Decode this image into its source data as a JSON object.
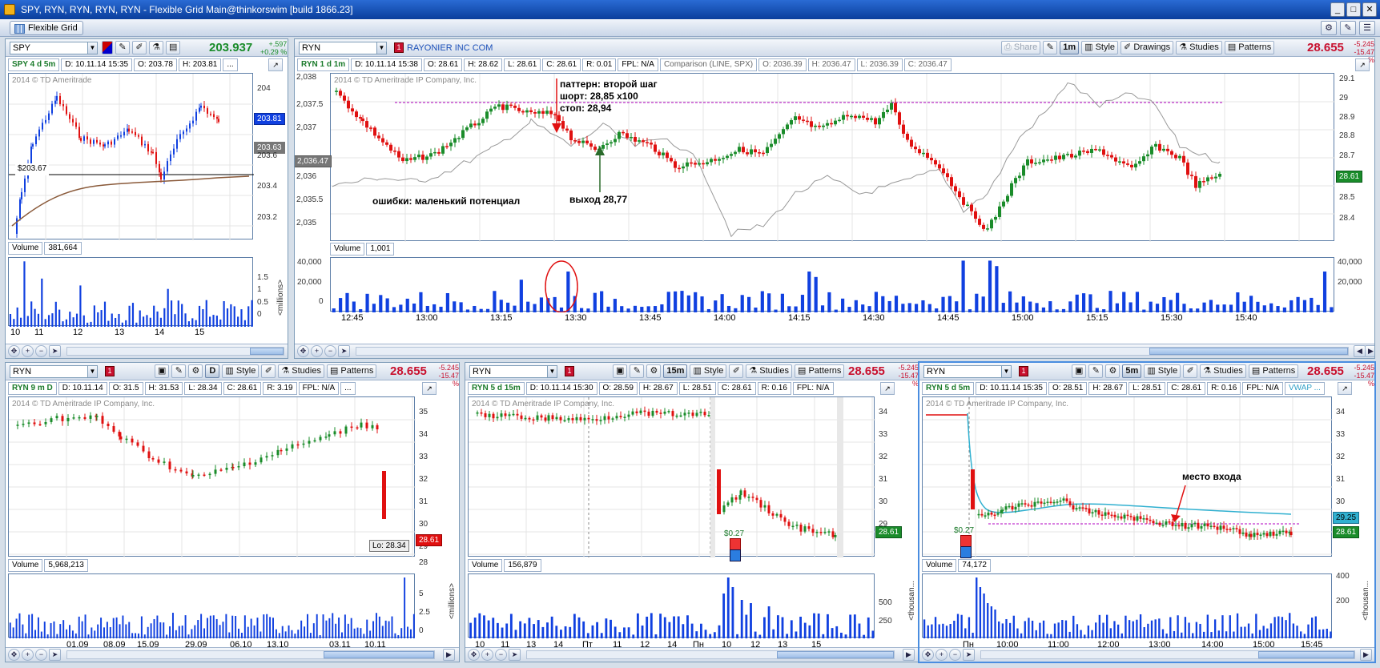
{
  "window": {
    "title": "SPY, RYN, RYN, RYN, RYN - Flexible Grid Main@thinkorswim [build 1866.23]"
  },
  "menubar": {
    "grid_label": "Flexible Grid"
  },
  "common": {
    "share": "Share",
    "style": "Style",
    "drawings": "Drawings",
    "studies": "Studies",
    "patterns": "Patterns",
    "volume": "Volume",
    "link": "1"
  },
  "colors": {
    "up": "#1a8c2a",
    "down": "#e01010",
    "price_blue": "#1040e0",
    "frame_active": "#4a8de0",
    "pink_line": "#b000c0",
    "vwap": "#30b0d0"
  },
  "spy": {
    "symbol": "SPY",
    "last": "203.937",
    "chg": "+.597",
    "pct": "+0.29 %",
    "info": {
      "name": "SPY 4 d 5m",
      "d": "D: 10.11.14 15:35",
      "o": "O: 203.78",
      "h": "H: 203.81"
    },
    "copyright": "2014 © TD Ameritrade",
    "yticks": [
      "204",
      "203.81",
      "203.63",
      "203.6",
      "203.4",
      "203.2"
    ],
    "level_label": "$203.67",
    "volume": "381,664",
    "vticks": [
      "1.5",
      "1",
      "0.5",
      "0"
    ],
    "vunit": "<millions>",
    "xticks": [
      "10",
      "11",
      "12",
      "13",
      "14",
      "15"
    ]
  },
  "ryn_main": {
    "symbol": "RYN",
    "company": "RAYONIER INC COM",
    "last": "28.655",
    "agg": "1m",
    "info": {
      "name": "RYN 1 d 1m",
      "d": "D: 10.11.14 15:38",
      "o": "O: 28.61",
      "h": "H: 28.62",
      "l": "L: 28.61",
      "c": "C: 28.61",
      "r": "R: 0.01",
      "fpl": "FPL: N/A",
      "cmp": "Comparison (LINE, SPX)",
      "co": "O: 2036.39",
      "ch": "H: 2036.47",
      "cl": "L: 2036.39",
      "cc": "C: 2036.47"
    },
    "copyright": "2014 © TD Ameritrade IP Company, Inc.",
    "lticks": [
      "2,038",
      "2,037.5",
      "2,037",
      "2,036.47",
      "2,036",
      "2,035.5",
      "2,035"
    ],
    "rticks": [
      "29.1",
      "29",
      "28.9",
      "28.8",
      "28.7",
      "28.61",
      "28.5",
      "28.4"
    ],
    "volume": "1,001",
    "vticks": [
      "40,000",
      "20,000",
      "0"
    ],
    "vrticks": [
      "40,000",
      "20,000"
    ],
    "xticks": [
      "12:45",
      "13:00",
      "13:15",
      "13:30",
      "13:45",
      "14:00",
      "14:15",
      "14:30",
      "14:45",
      "15:00",
      "15:15",
      "15:30",
      "15:40"
    ],
    "anno_pattern": "паттерн: второй шаг",
    "anno_short": "шорт: 28,85 x100",
    "anno_stop": "стоп: 28,94",
    "anno_err": "ошибки: маленький потенциал",
    "anno_exit": "выход 28,77"
  },
  "ryn_9m": {
    "symbol": "RYN",
    "last": "28.655",
    "chg": "-5.245",
    "pct": "-15.47 %",
    "agg": "D",
    "info": {
      "name": "RYN 9 m D",
      "d": "D: 10.11.14",
      "o": "O: 31.5",
      "h": "H: 31.53",
      "l": "L: 28.34",
      "c": "C: 28.61",
      "r": "R: 3.19",
      "fpl": "FPL: N/A"
    },
    "copyright": "2014 © TD Ameritrade IP Company, Inc.",
    "yticks": [
      "35",
      "34",
      "33",
      "32",
      "31",
      "30",
      "29",
      "28.61",
      "28"
    ],
    "lo_label": "Lo: 28.34",
    "volume": "5,968,213",
    "vticks": [
      "5",
      "2.5",
      "0"
    ],
    "vunit": "<millions>",
    "xticks": [
      "01.09",
      "08.09",
      "15.09",
      "29.09",
      "06.10",
      "13.10",
      "03.11",
      "10.11"
    ]
  },
  "ryn_5d15": {
    "symbol": "RYN",
    "last": "28.655",
    "chg": "-5.245",
    "pct": "-15.47 %",
    "agg": "15m",
    "info": {
      "name": "RYN 5 d 15m",
      "d": "D: 10.11.14 15:30",
      "o": "O: 28.59",
      "h": "H: 28.67",
      "l": "L: 28.51",
      "c": "C: 28.61",
      "r": "R: 0.16",
      "fpl": "FPL: N/A"
    },
    "copyright": "2014 © TD Ameritrade IP Company, Inc.",
    "yticks": [
      "34",
      "33",
      "32",
      "31",
      "30",
      "29",
      "28.61"
    ],
    "div_label": "$0.27",
    "volume": "156,879",
    "vticks": [
      "500",
      "250"
    ],
    "vunit": "<thousan...",
    "xticks": [
      "10",
      "11",
      "13",
      "14",
      "Пт",
      "11",
      "12",
      "14",
      "Пн",
      "10",
      "12",
      "13",
      "15"
    ]
  },
  "ryn_5d5": {
    "symbol": "RYN",
    "last": "28.655",
    "chg": "-5.245",
    "pct": "-15.47 %",
    "agg": "5m",
    "info": {
      "name": "RYN 5 d 5m",
      "d": "D: 10.11.14 15:35",
      "o": "O: 28.51",
      "h": "H: 28.67",
      "l": "L: 28.51",
      "c": "C: 28.61",
      "r": "R: 0.16",
      "fpl": "FPL: N/A",
      "vwap": "VWAP ..."
    },
    "copyright": "2014 © TD Ameritrade IP Company, Inc.",
    "yticks": [
      "34",
      "33",
      "32",
      "31",
      "30",
      "29.25",
      "28.61"
    ],
    "div_label": "$0.27",
    "anno_entry": "место входа",
    "volume": "74,172",
    "vticks": [
      "400",
      "200"
    ],
    "vunit": "<thousan...",
    "xticks": [
      "Пн",
      "10:00",
      "11:00",
      "12:00",
      "13:00",
      "14:00",
      "15:00",
      "15:45"
    ]
  }
}
